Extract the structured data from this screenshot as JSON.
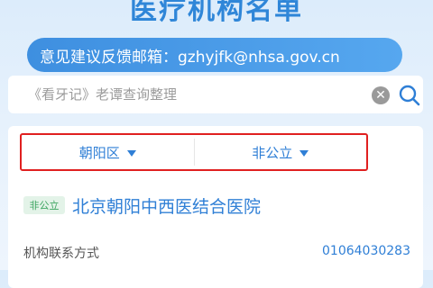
{
  "page": {
    "title": "医疗机构名单"
  },
  "feedback": {
    "text": "意见建议反馈邮箱：gzhyjfk@nhsa.gov.cn"
  },
  "search": {
    "placeholder": "《看牙记》老谭查询整理",
    "clear_icon": "clear-icon",
    "search_icon": "search-icon"
  },
  "filters": {
    "district": "朝阳区",
    "ownership": "非公立",
    "highlight_color": "#e02020"
  },
  "results": [
    {
      "tag": "非公立",
      "name": "北京朝阳中西医结合医院",
      "contact_label": "机构联系方式",
      "phone": "01064030283"
    }
  ],
  "colors": {
    "accent": "#2f7fd6",
    "tag_bg": "#e3f3e8",
    "tag_text": "#3ba45f"
  }
}
